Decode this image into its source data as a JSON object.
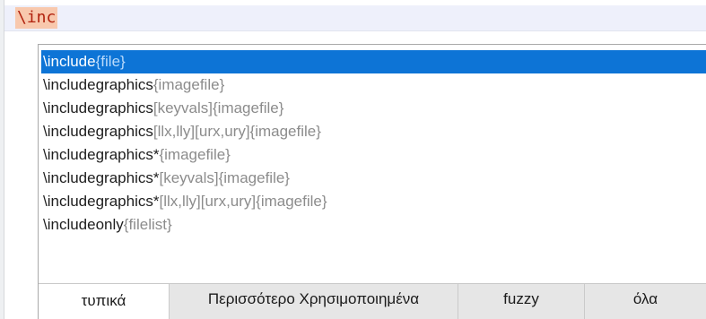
{
  "editor": {
    "typed_text": "\\inc"
  },
  "completion": {
    "items": [
      {
        "command": "\\include",
        "args": "{file}",
        "selected": true
      },
      {
        "command": "\\includegraphics",
        "args": "{imagefile}",
        "selected": false
      },
      {
        "command": "\\includegraphics",
        "args": "[keyvals]{imagefile}",
        "selected": false
      },
      {
        "command": "\\includegraphics",
        "args": "[llx,lly][urx,ury]{imagefile}",
        "selected": false
      },
      {
        "command": "\\includegraphics*",
        "args": "{imagefile}",
        "selected": false
      },
      {
        "command": "\\includegraphics*",
        "args": "[keyvals]{imagefile}",
        "selected": false
      },
      {
        "command": "\\includegraphics*",
        "args": "[llx,lly][urx,ury]{imagefile}",
        "selected": false
      },
      {
        "command": "\\includeonly",
        "args": "{filelist}",
        "selected": false
      }
    ],
    "tabs": [
      {
        "label": "τυπικά",
        "active": true
      },
      {
        "label": "Περισσότερο Χρησιμοποιημένα",
        "active": false
      },
      {
        "label": "fuzzy",
        "active": false
      },
      {
        "label": "όλα",
        "active": false
      }
    ]
  },
  "colors": {
    "selection": "#0d74d6",
    "argument_text": "#8c8c8c",
    "typed_text": "#b1210d",
    "typed_highlight": "#f8c8ad"
  }
}
